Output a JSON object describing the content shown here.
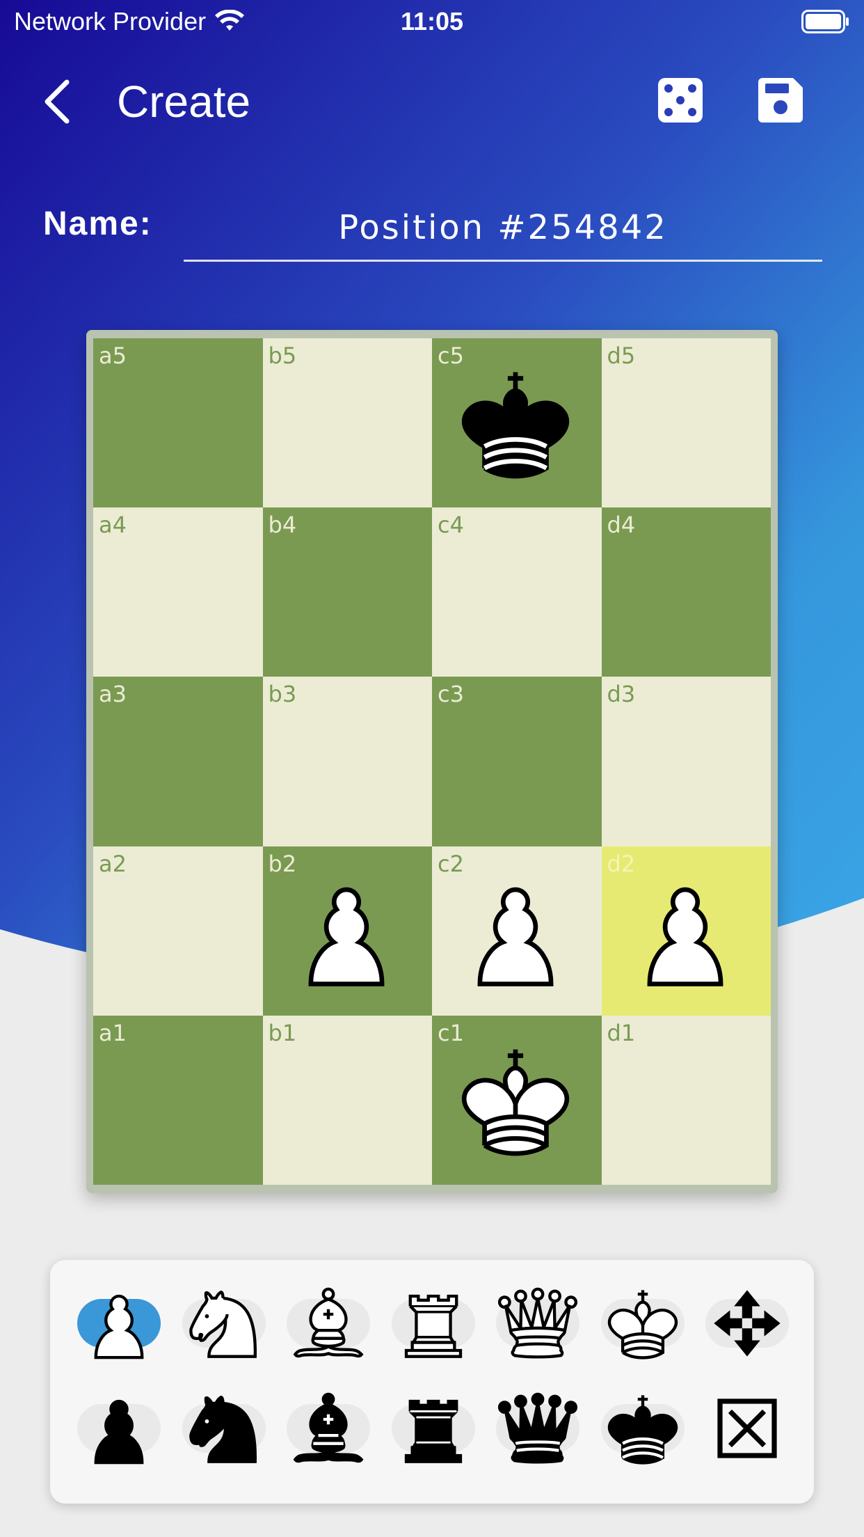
{
  "status_bar": {
    "carrier": "Network Provider",
    "time": "11:05"
  },
  "nav": {
    "title": "Create",
    "back_icon": "chevron-left-icon",
    "random_icon": "dice-icon",
    "save_icon": "save-icon"
  },
  "name_field": {
    "label": "Name:",
    "value": "Position #254842"
  },
  "board": {
    "files": [
      "a",
      "b",
      "c",
      "d"
    ],
    "ranks": [
      5,
      4,
      3,
      2,
      1
    ],
    "highlighted_square": "d2",
    "squares": [
      {
        "id": "a5",
        "coord": "a5",
        "color": "dark",
        "piece": ""
      },
      {
        "id": "b5",
        "coord": "b5",
        "color": "light",
        "piece": ""
      },
      {
        "id": "c5",
        "coord": "c5",
        "color": "dark",
        "piece": "black-king"
      },
      {
        "id": "d5",
        "coord": "d5",
        "color": "light",
        "piece": ""
      },
      {
        "id": "a4",
        "coord": "a4",
        "color": "light",
        "piece": ""
      },
      {
        "id": "b4",
        "coord": "b4",
        "color": "dark",
        "piece": ""
      },
      {
        "id": "c4",
        "coord": "c4",
        "color": "light",
        "piece": ""
      },
      {
        "id": "d4",
        "coord": "d4",
        "color": "dark",
        "piece": ""
      },
      {
        "id": "a3",
        "coord": "a3",
        "color": "dark",
        "piece": ""
      },
      {
        "id": "b3",
        "coord": "b3",
        "color": "light",
        "piece": ""
      },
      {
        "id": "c3",
        "coord": "c3",
        "color": "dark",
        "piece": ""
      },
      {
        "id": "d3",
        "coord": "d3",
        "color": "light",
        "piece": ""
      },
      {
        "id": "a2",
        "coord": "a2",
        "color": "light",
        "piece": ""
      },
      {
        "id": "b2",
        "coord": "b2",
        "color": "dark",
        "piece": "white-pawn"
      },
      {
        "id": "c2",
        "coord": "c2",
        "color": "light",
        "piece": "white-pawn"
      },
      {
        "id": "d2",
        "coord": "d2",
        "color": "highlight",
        "piece": "white-pawn"
      },
      {
        "id": "a1",
        "coord": "a1",
        "color": "dark",
        "piece": ""
      },
      {
        "id": "b1",
        "coord": "b1",
        "color": "light",
        "piece": ""
      },
      {
        "id": "c1",
        "coord": "c1",
        "color": "dark",
        "piece": "white-king"
      },
      {
        "id": "d1",
        "coord": "d1",
        "color": "light",
        "piece": ""
      }
    ]
  },
  "palette": {
    "selected": "white-pawn",
    "row1": [
      "white-pawn",
      "white-knight",
      "white-bishop",
      "white-rook",
      "white-queen",
      "white-king",
      "move-icon"
    ],
    "row2": [
      "black-pawn",
      "black-knight",
      "black-bishop",
      "black-rook",
      "black-queen",
      "black-king",
      "delete-icon"
    ]
  },
  "colors": {
    "hero_top": "#1a0f96",
    "hero_bottom": "#3aa0e2",
    "board_dark": "#7a9a52",
    "board_light": "#ececd5",
    "board_highlight": "#e6ea72",
    "palette_selected": "#3a97d8"
  }
}
